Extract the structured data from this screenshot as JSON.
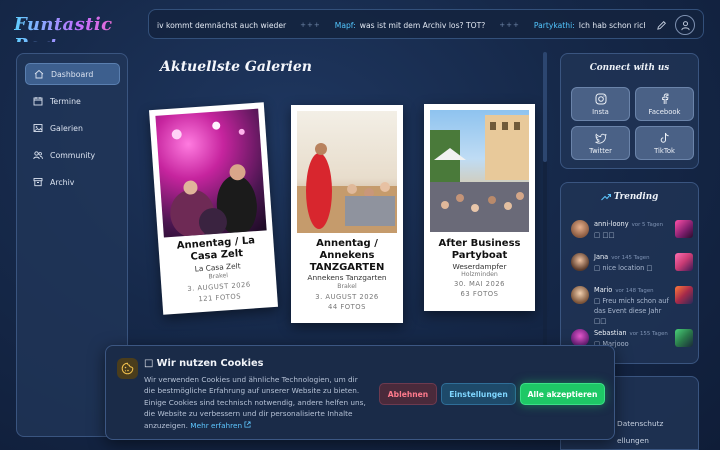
{
  "brand": {
    "logo_text": "Funtastic Party"
  },
  "ticker": {
    "items": [
      {
        "user": "",
        "text": "iv kommt demnächst auch wieder"
      },
      {
        "user": "Mapf:",
        "text": "was ist mit dem Archiv los? TOT?"
      },
      {
        "user": "Partykathi:",
        "text": "Ich hab schon richtig Bock"
      }
    ],
    "separator": "+++"
  },
  "sidebar": {
    "items": [
      {
        "label": "Dashboard",
        "icon": "home-icon",
        "active": true
      },
      {
        "label": "Termine",
        "icon": "calendar-icon",
        "active": false
      },
      {
        "label": "Galerien",
        "icon": "image-icon",
        "active": false
      },
      {
        "label": "Community",
        "icon": "users-icon",
        "active": false
      },
      {
        "label": "Archiv",
        "icon": "archive-icon",
        "active": false
      }
    ]
  },
  "main": {
    "title": "Aktuellste Galerien",
    "galleries": [
      {
        "title": "Annentag / La Casa Zelt",
        "subtitle": "La Casa Zelt",
        "location": "Brakel",
        "date": "3. AUGUST 2026",
        "count": "121 FOTOS"
      },
      {
        "title": "Annentag / Annekens TANZGARTEN",
        "subtitle": "Annekens Tanzgarten",
        "location": "Brakel",
        "date": "3. AUGUST 2026",
        "count": "44 FOTOS"
      },
      {
        "title": "After Business Partyboat",
        "subtitle": "Weserdampfer",
        "location": "Holzminden",
        "date": "30. MAI 2026",
        "count": "63 FOTOS"
      }
    ]
  },
  "connect": {
    "title": "Connect with us",
    "buttons": [
      {
        "label": "Insta",
        "icon": "instagram-icon"
      },
      {
        "label": "Facebook",
        "icon": "facebook-icon"
      },
      {
        "label": "Twitter",
        "icon": "twitter-icon"
      },
      {
        "label": "TikTok",
        "icon": "tiktok-icon"
      }
    ]
  },
  "trending": {
    "title": "Trending",
    "items": [
      {
        "name": "anni-loony",
        "time": "vor 5 Tagen",
        "message": "□ □□"
      },
      {
        "name": "Jana",
        "time": "vor 145 Tagen",
        "message": "□ nice location □"
      },
      {
        "name": "Mario",
        "time": "vor 148 Tagen",
        "message": "□ Freu mich schon auf das Event diese Jahr □□"
      },
      {
        "name": "Sebastian",
        "time": "vor 155 Tagen",
        "message": "□ Marjooo"
      }
    ]
  },
  "footer": {
    "links": [
      "Datenschutz",
      "ellungen"
    ]
  },
  "cookie": {
    "title": "□ Wir nutzen Cookies",
    "text": "Wir verwenden Cookies und ähnliche Technologien, um dir die bestmögliche Erfahrung auf unserer Website zu bieten. Einige Cookies sind technisch notwendig, andere helfen uns, die Website zu verbessern und dir personalisierte Inhalte anzuzeigen.",
    "link": "Mehr erfahren",
    "decline": "Ablehnen",
    "settings": "Einstellungen",
    "accept": "Alle akzeptieren"
  }
}
